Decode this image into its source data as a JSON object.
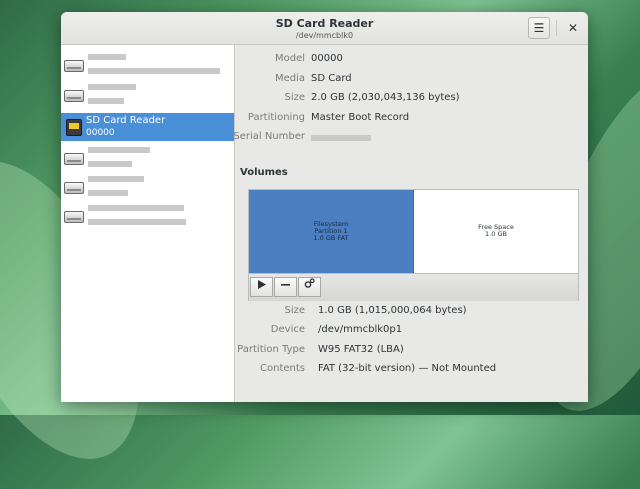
{
  "window": {
    "title": "SD Card Reader",
    "subtitle": "/dev/mmcblk0"
  },
  "header": {
    "menu_icon": "hamburger-menu-icon",
    "close_icon": "close-icon",
    "menu_glyph": "☰",
    "close_glyph": "✕"
  },
  "sidebar": {
    "selected": {
      "name": "SD Card Reader",
      "subtitle": "00000",
      "icon": "sd-card-icon"
    },
    "other_icon": "hard-drive-icon"
  },
  "device": {
    "labels": {
      "model": "Model",
      "media": "Media",
      "size": "Size",
      "partitioning": "Partitioning",
      "serial": "Serial Number"
    },
    "values": {
      "model": "00000",
      "media": "SD Card",
      "size": "2.0 GB (2,030,043,136 bytes)",
      "partitioning": "Master Boot Record"
    }
  },
  "volumes": {
    "title": "Volumes",
    "partition": {
      "line1": "Filesystem",
      "line2": "Partition 1",
      "line3": "1.0 GB FAT"
    },
    "free": {
      "line1": "Free Space",
      "line2": "1.0 GB"
    },
    "toolbar": {
      "play_icon": "play-icon",
      "minus_icon": "minus-icon",
      "gear_icon": "gears-icon"
    },
    "colors": {
      "partition": "#4a7fc1",
      "selection": "#4a90d9"
    }
  },
  "volume_details": {
    "labels": {
      "size": "Size",
      "device": "Device",
      "partition_type": "Partition Type",
      "contents": "Contents"
    },
    "values": {
      "size": "1.0 GB (1,015,000,064 bytes)",
      "device": "/dev/mmcblk0p1",
      "partition_type": "W95 FAT32 (LBA)",
      "contents": "FAT (32-bit version) — Not Mounted"
    }
  }
}
